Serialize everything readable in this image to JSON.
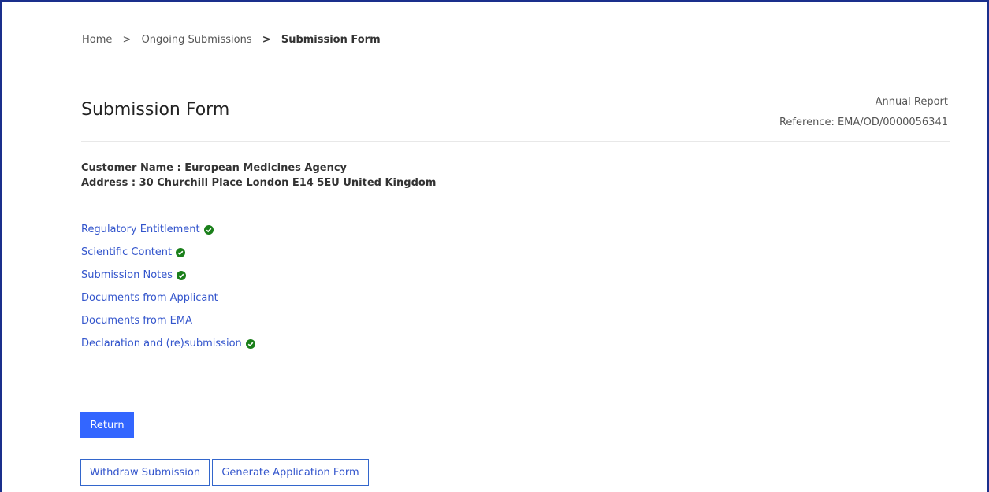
{
  "breadcrumb": {
    "items": [
      "Home",
      "Ongoing Submissions"
    ],
    "current": "Submission Form",
    "separator": ">"
  },
  "page": {
    "title": "Submission Form",
    "report_type": "Annual Report",
    "reference": "Reference: EMA/OD/0000056341"
  },
  "customer": {
    "name_line": "Customer Name : European Medicines Agency",
    "address_line": "Address : 30 Churchill Place London E14 5EU United Kingdom"
  },
  "sections": [
    {
      "label": "Regulatory Entitlement",
      "completed": true
    },
    {
      "label": "Scientific Content",
      "completed": true
    },
    {
      "label": "Submission Notes",
      "completed": true
    },
    {
      "label": "Documents from Applicant",
      "completed": false
    },
    {
      "label": "Documents from EMA",
      "completed": false
    },
    {
      "label": "Declaration and (re)submission",
      "completed": true
    }
  ],
  "buttons": {
    "return": "Return",
    "withdraw": "Withdraw Submission",
    "generate": "Generate Application Form"
  },
  "colors": {
    "link": "#3355cc",
    "primary": "#3366ff",
    "check": "#1a7f1a",
    "frame": "#1a2f8c"
  },
  "icons": {
    "completed": "check-circle-icon"
  }
}
